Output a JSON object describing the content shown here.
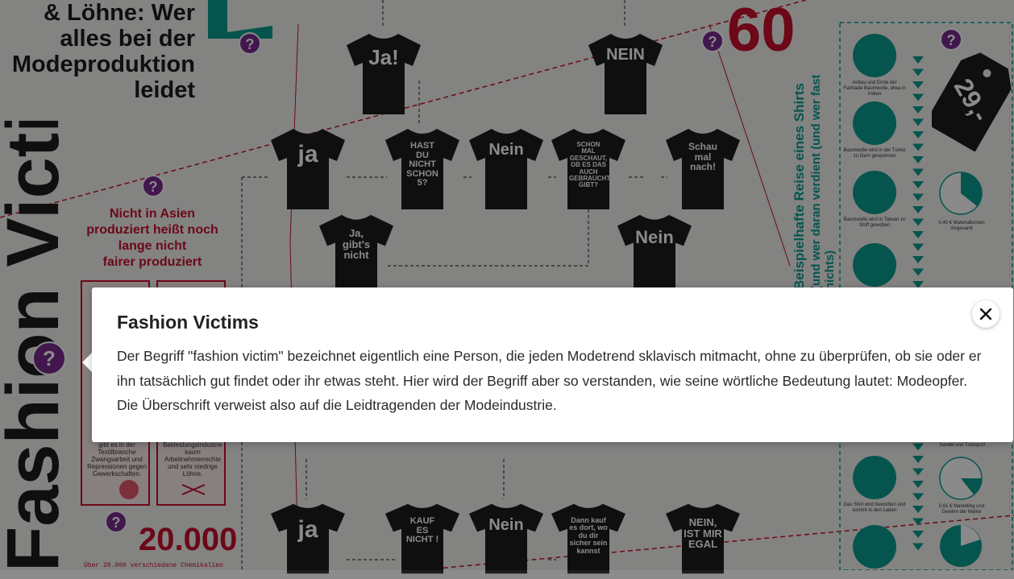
{
  "poster": {
    "title_lines": [
      "& Löhne: Wer",
      "alles bei der",
      "Modeproduktion",
      "leidet"
    ],
    "vertical_title": "Fashion Victims",
    "stat_60": "60",
    "stat_20000": "20.000",
    "stat_20000_caption": "Über 20.000 verschiedene Chemikalien",
    "asia_note": [
      "Nicht in Asien",
      "produziert heißt noch",
      "lange nicht",
      "fairer produziert"
    ],
    "box_left_text": "gibt es in der Textilbranche Zwangsarbeit und Repressionen gegen Gewerkschaften.",
    "box_right_text": "Bekleidungsindustrie kaum Arbeitnehmerrechte und sehr niedrige Löhne.",
    "price_tag": "29,-",
    "journey_text_1": "Beispielhafte Reise eines Shirts",
    "journey_text_2": "(und wer daran verdient (und wer fast nichts)",
    "shirts": [
      {
        "label": "Ja!"
      },
      {
        "label": "NEIN"
      },
      {
        "label": "ja"
      },
      {
        "label": "HAST DU NICHT SCHON 5?"
      },
      {
        "label": "Nein"
      },
      {
        "label": "SCHON MAL GESCHAUT, OB ES DAS AUCH GEBRAUCHT GIBT?"
      },
      {
        "label": "Schau mal nach!"
      },
      {
        "label": "Ja, gibt's nicht"
      },
      {
        "label": "Nein"
      },
      {
        "label": "ja"
      },
      {
        "label": "KAUF ES NICHT !"
      },
      {
        "label": "Nein"
      },
      {
        "label": "Dann kauf es dort, wo du dir sicher sein kannst"
      },
      {
        "label": "NEIN, IST MIR EGAL"
      }
    ],
    "steps": [
      "Anbau und Ernte der Fairtrade Baumwolle, etwa in Indien",
      "Baumwolle wird in der Türkei zu Garn gesponnen",
      "Baumwolle wird in Taiwan zu Stoff gewoben",
      "Das Shirt wird beworben und kommt in den Laden"
    ],
    "cost_labels": [
      "0,40 € Materialkosten insgesamt",
      "0,61 € Marketing und Gewinn der Marke",
      "handel und Transport"
    ]
  },
  "popup": {
    "title": "Fashion Victims",
    "body": "Der Begriff \"fashion victim\" bezeichnet eigentlich eine Person, die jeden Modetrend sklavisch mitmacht, ohne zu überprüfen, ob sie oder er ihn tatsächlich gut findet oder ihr etwas steht. Hier wird der Begriff aber so verstanden, wie seine wörtliche Bedeutung lautet: Modeopfer. Die Überschrift verweist also auf die Leidtragenden der Modeindustrie.",
    "close_icon": "close-icon"
  },
  "colors": {
    "accent_purple": "#7a2c8e",
    "accent_red": "#c8102e",
    "accent_teal": "#0a9e90"
  }
}
